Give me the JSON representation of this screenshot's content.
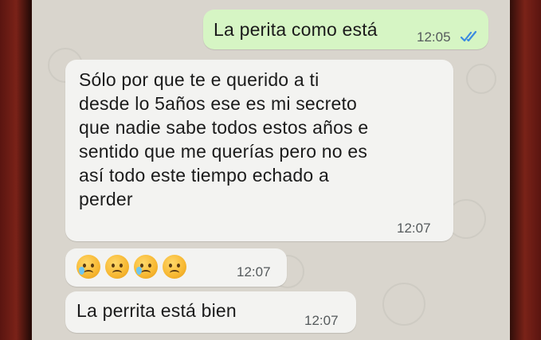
{
  "chat": {
    "messages": [
      {
        "direction": "outgoing",
        "text": "La perita como está",
        "time": "12:05",
        "status": "read-double-check-icon",
        "status_color": "#3b8be0"
      },
      {
        "direction": "incoming",
        "lines": [
          "Sólo por que te e querido a ti",
          "desde lo 5años ese es mi secreto",
          "que nadie sabe todos estos años e",
          "sentido que me querías pero no es",
          "así todo este tiempo echado a",
          "perder"
        ],
        "time": "12:07"
      },
      {
        "direction": "incoming",
        "emojis": [
          "sad-tear-face-icon",
          "sad-face-icon",
          "sad-tear-face-icon",
          "sad-face-icon"
        ],
        "time": "12:07"
      },
      {
        "direction": "incoming",
        "text": "La perrita está bien",
        "time": "12:07"
      }
    ]
  },
  "colors": {
    "outgoing_bubble": "#d6f5c4",
    "incoming_bubble": "#f3f3f1",
    "wallpaper": "#d9d5cd",
    "phone_case": "#6b1a14"
  }
}
